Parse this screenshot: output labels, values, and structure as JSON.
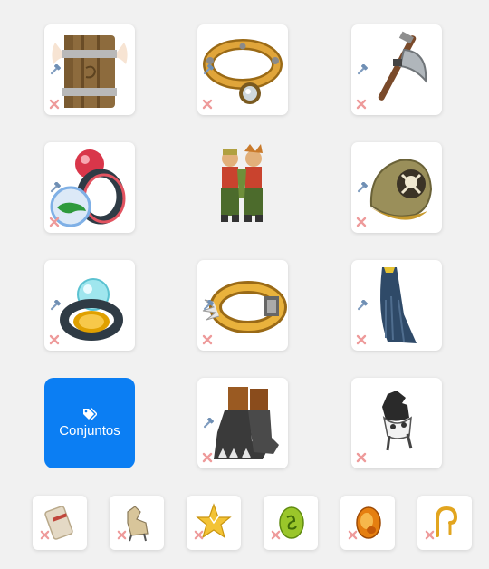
{
  "equipment": {
    "slots": [
      {
        "name": "shield-slot",
        "icon": "wooden-shield-icon"
      },
      {
        "name": "amulet-slot",
        "icon": "amulet-icon"
      },
      {
        "name": "weapon-slot",
        "icon": "axe-icon"
      },
      {
        "name": "ring-left-slot",
        "icon": "red-ring-icon",
        "overlay_icon": "green-crocodile-badge-icon"
      },
      {
        "name": "hat-slot",
        "icon": "skull-hat-icon"
      },
      {
        "name": "ring-right-slot",
        "icon": "crystal-ring-icon"
      },
      {
        "name": "belt-slot",
        "icon": "spiked-belt-icon"
      },
      {
        "name": "cloak-slot",
        "icon": "cloak-icon"
      },
      {
        "name": "boots-slot",
        "icon": "boots-icon"
      },
      {
        "name": "pet-slot",
        "icon": "pet-mount-icon"
      }
    ],
    "character_icon": "character-preview-icon",
    "slot_actions": {
      "hammer": "hammer-icon",
      "remove": "remove-x-icon"
    }
  },
  "sets_button": {
    "label": "Conjuntos",
    "icon": "tags-icon",
    "color": "#0b7ef3"
  },
  "dofus_slots": [
    {
      "name": "dofus-slot-1",
      "icon": "parchment-scroll-icon"
    },
    {
      "name": "dofus-slot-2",
      "icon": "dragoturkey-figurine-icon"
    },
    {
      "name": "dofus-slot-3",
      "icon": "gold-star-crystal-icon"
    },
    {
      "name": "dofus-slot-4",
      "icon": "green-dofus-egg-icon"
    },
    {
      "name": "dofus-slot-5",
      "icon": "orange-dofus-egg-icon"
    },
    {
      "name": "dofus-slot-6",
      "icon": "gold-hook-icon"
    }
  ]
}
